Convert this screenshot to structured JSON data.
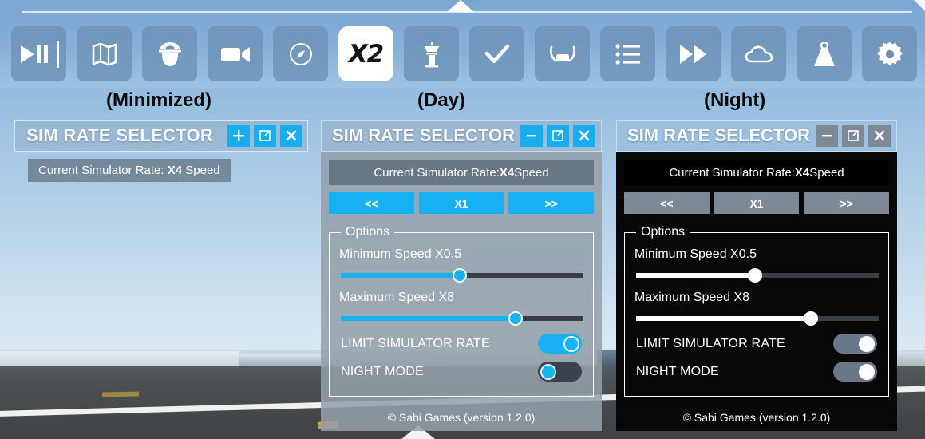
{
  "toolbar": {
    "buttons": [
      {
        "name": "play-pause-icon",
        "label": "Play / Pause",
        "active": false
      },
      {
        "name": "map-icon",
        "label": "Map",
        "active": false
      },
      {
        "name": "pilot-icon",
        "label": "Pilot",
        "active": false
      },
      {
        "name": "camera-icon",
        "label": "Camera",
        "active": false
      },
      {
        "name": "compass-icon",
        "label": "Compass",
        "active": false
      },
      {
        "name": "sim-rate-x2-icon",
        "label": "X2",
        "active": true
      },
      {
        "name": "control-tower-icon",
        "label": "ATC Tower",
        "active": false
      },
      {
        "name": "checkmark-icon",
        "label": "Checklist",
        "active": false
      },
      {
        "name": "seatbelt-icon",
        "label": "Seatbelt",
        "active": false
      },
      {
        "name": "list-icon",
        "label": "List",
        "active": false
      },
      {
        "name": "fast-forward-icon",
        "label": "Fast Forward",
        "active": false
      },
      {
        "name": "cloud-icon",
        "label": "Weather",
        "active": false
      },
      {
        "name": "weight-icon",
        "label": "Weight and Balance",
        "active": false
      },
      {
        "name": "gear-icon",
        "label": "Settings",
        "active": false
      }
    ],
    "active_label": "X2"
  },
  "captions": {
    "minimized": "(Minimized)",
    "day": "(Day)",
    "night": "(Night)"
  },
  "panel_minimized": {
    "title": "SIM RATE SELECTOR",
    "window_buttons": [
      {
        "name": "expand-plus-button",
        "glyph": "+"
      },
      {
        "name": "popout-button",
        "glyph": "popout"
      },
      {
        "name": "close-button",
        "glyph": "x"
      }
    ],
    "rate_text_prefix": "Current Simulator Rate: ",
    "rate_value": "X4",
    "rate_text_suffix": " Speed"
  },
  "panel_day": {
    "title": "SIM RATE SELECTOR",
    "window_buttons": [
      {
        "name": "minimize-button",
        "glyph": "minus"
      },
      {
        "name": "popout-button",
        "glyph": "popout"
      },
      {
        "name": "close-button",
        "glyph": "x"
      }
    ],
    "rate_text_prefix": "Current Simulator Rate: ",
    "rate_value": "X4",
    "rate_text_suffix": " Speed",
    "rate_buttons": [
      "<<",
      "X1",
      ">>"
    ],
    "options_legend": "Options",
    "min_speed_label": "Minimum Speed X0.5",
    "min_speed_percent": 49,
    "max_speed_label": "Maximum Speed X8",
    "max_speed_percent": 72,
    "limit_label": "LIMIT SIMULATOR RATE",
    "limit_on": true,
    "night_label": "NIGHT MODE",
    "night_on": false,
    "footer": "© Sabi Games (version 1.2.0)"
  },
  "panel_night": {
    "title": "SIM RATE SELECTOR",
    "window_buttons": [
      {
        "name": "minimize-button",
        "glyph": "minus"
      },
      {
        "name": "popout-button",
        "glyph": "popout"
      },
      {
        "name": "close-button",
        "glyph": "x"
      }
    ],
    "rate_text_prefix": "Current Simulator Rate: ",
    "rate_value": "X4",
    "rate_text_suffix": " Speed",
    "rate_buttons": [
      "<<",
      "X1",
      ">>"
    ],
    "options_legend": "Options",
    "min_speed_label": "Minimum Speed X0.5",
    "min_speed_percent": 49,
    "max_speed_label": "Maximum Speed X8",
    "max_speed_percent": 72,
    "limit_label": "LIMIT SIMULATOR RATE",
    "limit_on": true,
    "night_label": "NIGHT MODE",
    "night_on": true,
    "footer": "© Sabi Games (version 1.2.0)"
  },
  "colors": {
    "accent_blue": "#18b2f4",
    "toolbar_blue": "#85aed7",
    "panel_dark": "#080808",
    "track_dark": "#373c45",
    "night_button_gray": "#7d8a96"
  }
}
